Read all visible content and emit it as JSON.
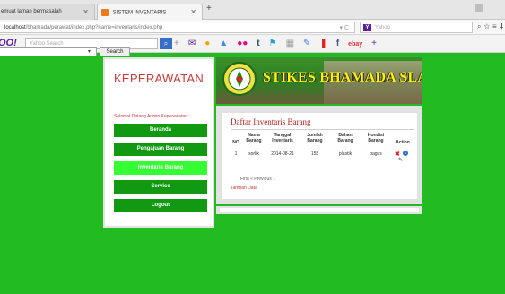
{
  "browser": {
    "tabs": [
      {
        "label": "emuat laman bermasalah"
      },
      {
        "label": "SISTEM INVENTARIS"
      }
    ],
    "url_host": "localhost",
    "url_path": "/bhamada/perawat/index.php?name=inventaris/index.php",
    "yahoo_placeholder": "Yahoo",
    "toolbar_logo": "OO!",
    "toolbar_search_placeholder": "Yahoo Search",
    "search_button": "Search"
  },
  "sidebar": {
    "title": "KEPERAWATAN",
    "welcome": "Selamat Datang Admin Keperawatan :",
    "menu": [
      {
        "label": "Beranda"
      },
      {
        "label": "Pengajuan Barang"
      },
      {
        "label": "Inventaris Barang"
      },
      {
        "label": "Service"
      },
      {
        "label": "Logout"
      }
    ]
  },
  "banner": {
    "title": "STIKES BHAMADA SLAWI"
  },
  "content": {
    "title": "Daftar Inventaris Barang",
    "columns": [
      "NO",
      "Nama Barang",
      "Tanggal Inventaris",
      "Jumlah Barang",
      "Bahan Barang",
      "Kondisi Barang",
      "Action"
    ],
    "rows": [
      {
        "no": "1",
        "nama": "sorlik",
        "tanggal": "2014-08-21",
        "jumlah": "155",
        "bahan": "plastik",
        "kondisi": "bagus"
      }
    ],
    "pager": "First « Previous 1",
    "add_link": "Tambah Data"
  },
  "colors": {
    "page_green": "#22bb22",
    "menu_green": "#119911",
    "menu_active": "#33ff33",
    "title_red": "#c53a3a",
    "banner_text": "#fff200"
  }
}
